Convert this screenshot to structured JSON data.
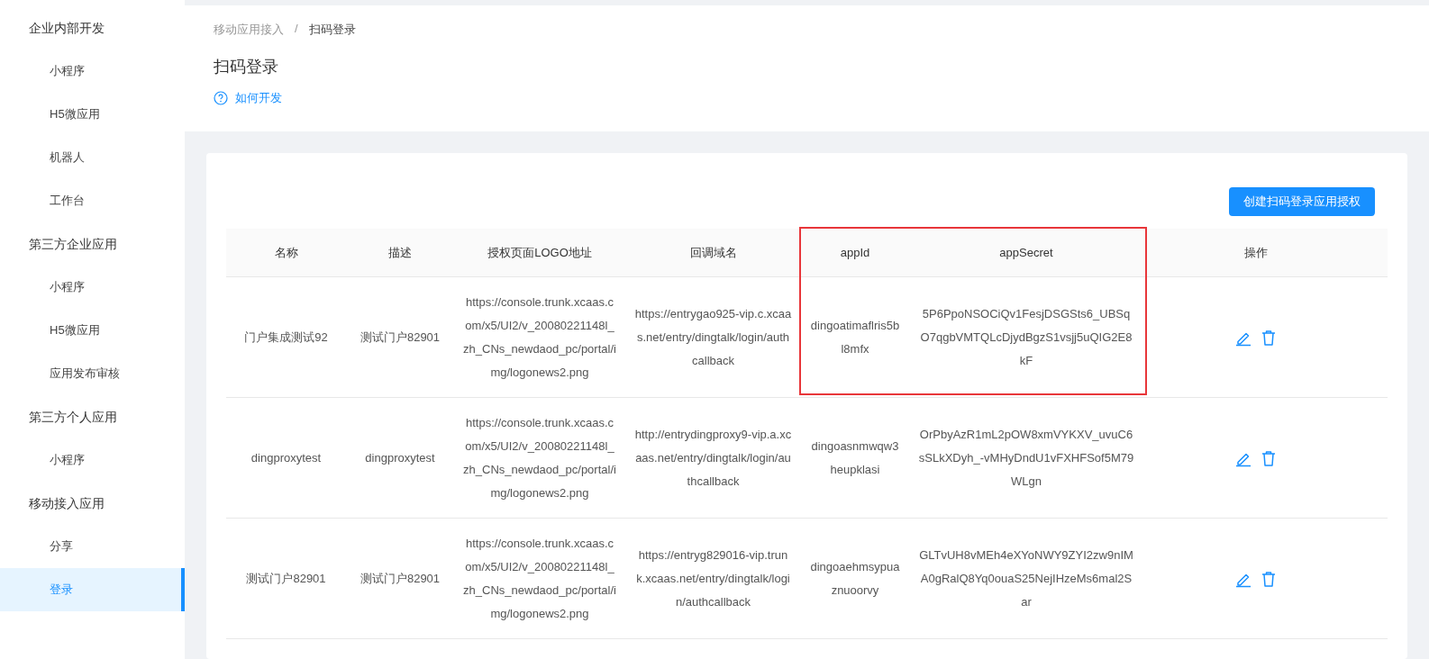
{
  "sidebar": {
    "groups": [
      {
        "title": "企业内部开发",
        "items": [
          {
            "label": "小程序",
            "selected": false
          },
          {
            "label": "H5微应用",
            "selected": false
          },
          {
            "label": "机器人",
            "selected": false
          },
          {
            "label": "工作台",
            "selected": false
          }
        ]
      },
      {
        "title": "第三方企业应用",
        "items": [
          {
            "label": "小程序",
            "selected": false
          },
          {
            "label": "H5微应用",
            "selected": false
          },
          {
            "label": "应用发布审核",
            "selected": false
          }
        ]
      },
      {
        "title": "第三方个人应用",
        "items": [
          {
            "label": "小程序",
            "selected": false
          }
        ]
      },
      {
        "title": "移动接入应用",
        "items": [
          {
            "label": "分享",
            "selected": false
          },
          {
            "label": "登录",
            "selected": true
          }
        ]
      }
    ]
  },
  "breadcrumb": [
    "移动应用接入",
    "扫码登录"
  ],
  "breadcrumb_separator": "/",
  "page_title": "扫码登录",
  "help_link": "如何开发",
  "create_button": "创建扫码登录应用授权",
  "table": {
    "columns": [
      "名称",
      "描述",
      "授权页面LOGO地址",
      "回调域名",
      "appId",
      "appSecret",
      "操作"
    ],
    "rows": [
      {
        "name": "门户集成测试92",
        "description": "测试门户82901",
        "logo_url": "https://console.trunk.xcaas.com/x5/UI2/v_20080221148l_zh_CNs_newdaod_pc/portal/img/logonews2.png",
        "callback_domain": "https://entrygao925-vip.c.xcaas.net/entry/dingtalk/login/authcallback",
        "app_id": "dingoatimaflris5bl8mfx",
        "app_secret": "5P6PpoNSOCiQv1FesjDSGSts6_UBSqO7qgbVMTQLcDjydBgzS1vsjj5uQIG2E8kF"
      },
      {
        "name": "dingproxytest",
        "description": "dingproxytest",
        "logo_url": "https://console.trunk.xcaas.com/x5/UI2/v_20080221148l_zh_CNs_newdaod_pc/portal/img/logonews2.png",
        "callback_domain": "http://entrydingproxy9-vip.a.xcaas.net/entry/dingtalk/login/authcallback",
        "app_id": "dingoasnmwqw3heupklasi",
        "app_secret": "OrPbyAzR1mL2pOW8xmVYKXV_uvuC6sSLkXDyh_-vMHyDndU1vFXHFSof5M79WLgn"
      },
      {
        "name": "测试门户82901",
        "description": "测试门户82901",
        "logo_url": "https://console.trunk.xcaas.com/x5/UI2/v_20080221148l_zh_CNs_newdaod_pc/portal/img/logonews2.png",
        "callback_domain": "https://entryg829016-vip.trunk.xcaas.net/entry/dingtalk/login/authcallback",
        "app_id": "dingoaehmsypuaznuoorvy",
        "app_secret": "GLTvUH8vMEh4eXYoNWY9ZYI2zw9nIMA0gRalQ8Yq0ouaS25NejIHzeMs6mal2Sar"
      }
    ]
  }
}
